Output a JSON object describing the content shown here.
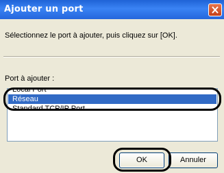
{
  "window": {
    "title": "Ajouter un port",
    "close_icon": "close-icon"
  },
  "main": {
    "instruction": "Sélectionnez le port à ajouter, puis cliquez sur [OK].",
    "port_label": "Port à ajouter :",
    "list": {
      "items": [
        "Local Port",
        "Réseau",
        "Standard TCP/IP Port"
      ],
      "selected": "Réseau"
    }
  },
  "buttons": {
    "ok_label": "OK",
    "cancel_label": "Annuler"
  },
  "colors": {
    "titlebar": "#2566dc",
    "selection": "#316ac5",
    "dialog_bg": "#ece9d8",
    "close_button": "#d9542b",
    "highlight": "#000000"
  }
}
